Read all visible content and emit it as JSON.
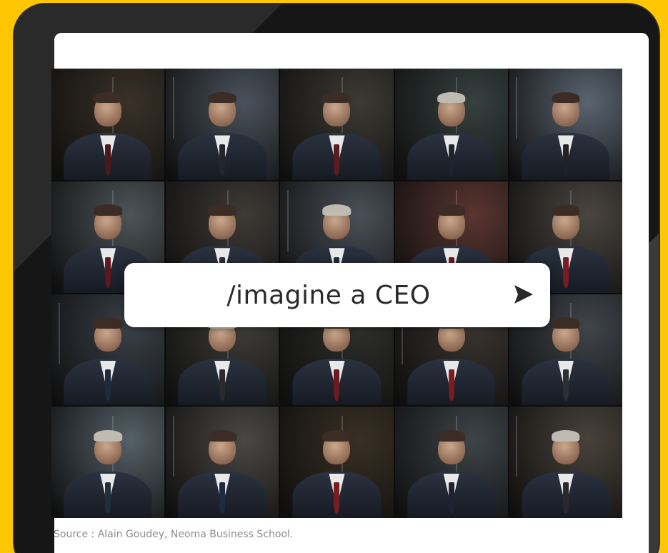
{
  "prompt": {
    "text": "/imagine a CEO",
    "send_icon": "send-arrow-icon"
  },
  "caption": "Source : Alain Goudey, Neoma Business School.",
  "colors": {
    "background": "#fec702",
    "frame": "#161616",
    "screen": "#ffffff",
    "caption_text": "#8c8c8c"
  },
  "gallery": {
    "rows": 4,
    "columns": 5,
    "tiles": [
      {
        "bg": "#3a3128",
        "tie": "#4a1a1a"
      },
      {
        "bg": "#4a525c",
        "tie": "#23262c"
      },
      {
        "bg": "#3c3a33",
        "tie": "#5a1c1c"
      },
      {
        "bg": "#36413f",
        "tie": "#1d2330"
      },
      {
        "bg": "#5a6470",
        "tie": "#1f2228"
      },
      {
        "bg": "#4d5458",
        "tie": "#5a1a1f"
      },
      {
        "bg": "#3e3a36",
        "tie": "#2b2f36"
      },
      {
        "bg": "#4a5058",
        "tie": "#202a38"
      },
      {
        "bg": "#5a3530",
        "tie": "#6b1a1f"
      },
      {
        "bg": "#4a4540",
        "tie": "#7a1d20"
      },
      {
        "bg": "#3a4048",
        "tie": "#1f2a3a"
      },
      {
        "bg": "#3d3c38",
        "tie": "#2a2a2e"
      },
      {
        "bg": "#2e2e2c",
        "tie": "#6b1a1f"
      },
      {
        "bg": "#3a3430",
        "tie": "#7a1d20"
      },
      {
        "bg": "#40454a",
        "tie": "#2b2f36"
      },
      {
        "bg": "#556068",
        "tie": "#20303a"
      },
      {
        "bg": "#4a4844",
        "tie": "#1e2a40"
      },
      {
        "bg": "#3a3024",
        "tie": "#7a1d20"
      },
      {
        "bg": "#3e4448",
        "tie": "#1d2330"
      },
      {
        "bg": "#48423a",
        "tie": "#2a2a2e"
      }
    ]
  }
}
